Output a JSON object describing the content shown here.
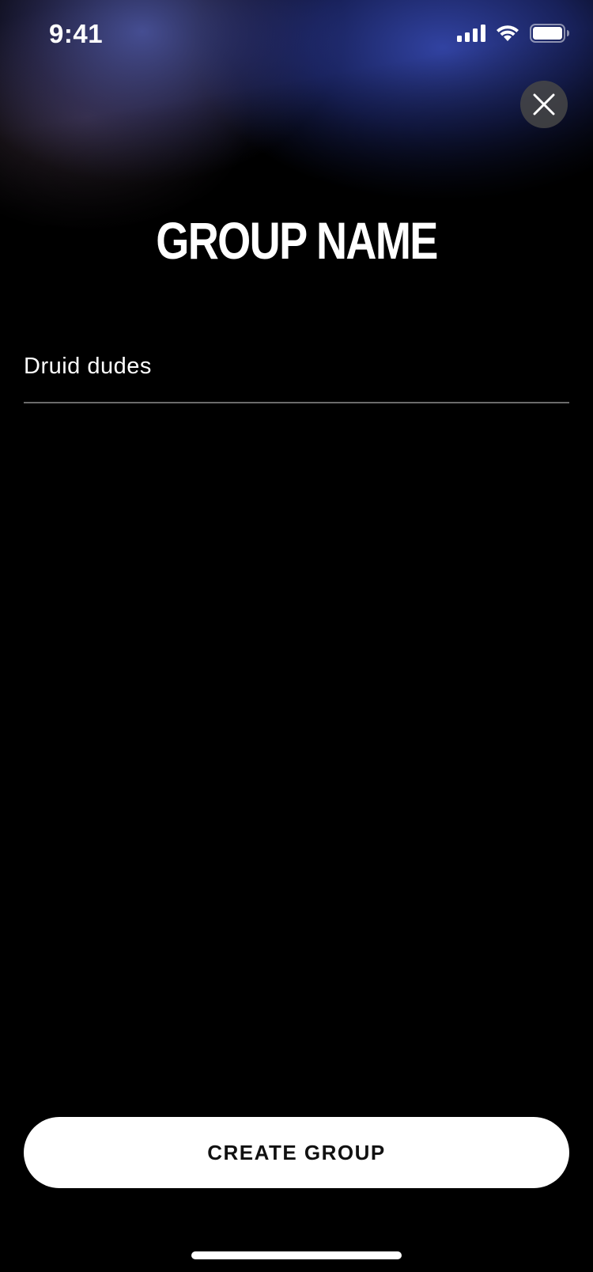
{
  "status_bar": {
    "time": "9:41",
    "icons": [
      "signal-icon",
      "wifi-icon",
      "battery-icon"
    ]
  },
  "header": {
    "close_icon": "close-icon",
    "title": "GROUP NAME"
  },
  "form": {
    "group_name_value": "Druid dudes"
  },
  "footer": {
    "create_button_label": "CREATE GROUP"
  },
  "colors": {
    "background": "#000000",
    "accent_glow": "#3446aa",
    "button_bg": "#ffffff",
    "button_text": "#111111",
    "divider": "#6b6b6b"
  }
}
